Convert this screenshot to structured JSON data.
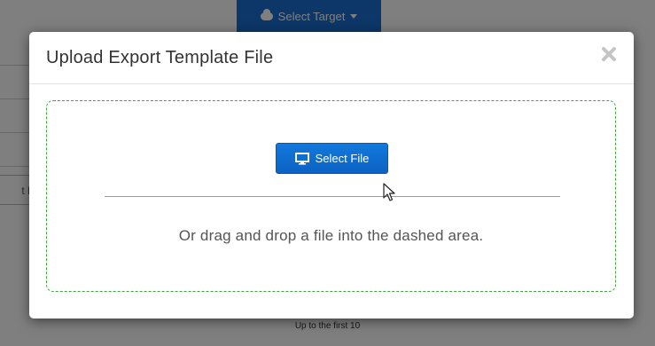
{
  "background": {
    "target_button_label": "Select Target",
    "input_partial_text": "t Pr",
    "footer_note": "Up to the first 10"
  },
  "modal": {
    "title": "Upload Export Template File",
    "close_icon": "close-icon",
    "select_file_label": "Select File",
    "select_file_icon": "monitor-icon",
    "drop_hint": "Or drag and drop a file into the dashed area."
  },
  "colors": {
    "primary_button": "#0b6ad0",
    "dropzone_border": "#3fa63f",
    "overlay": "rgba(0,0,0,0.5)"
  }
}
